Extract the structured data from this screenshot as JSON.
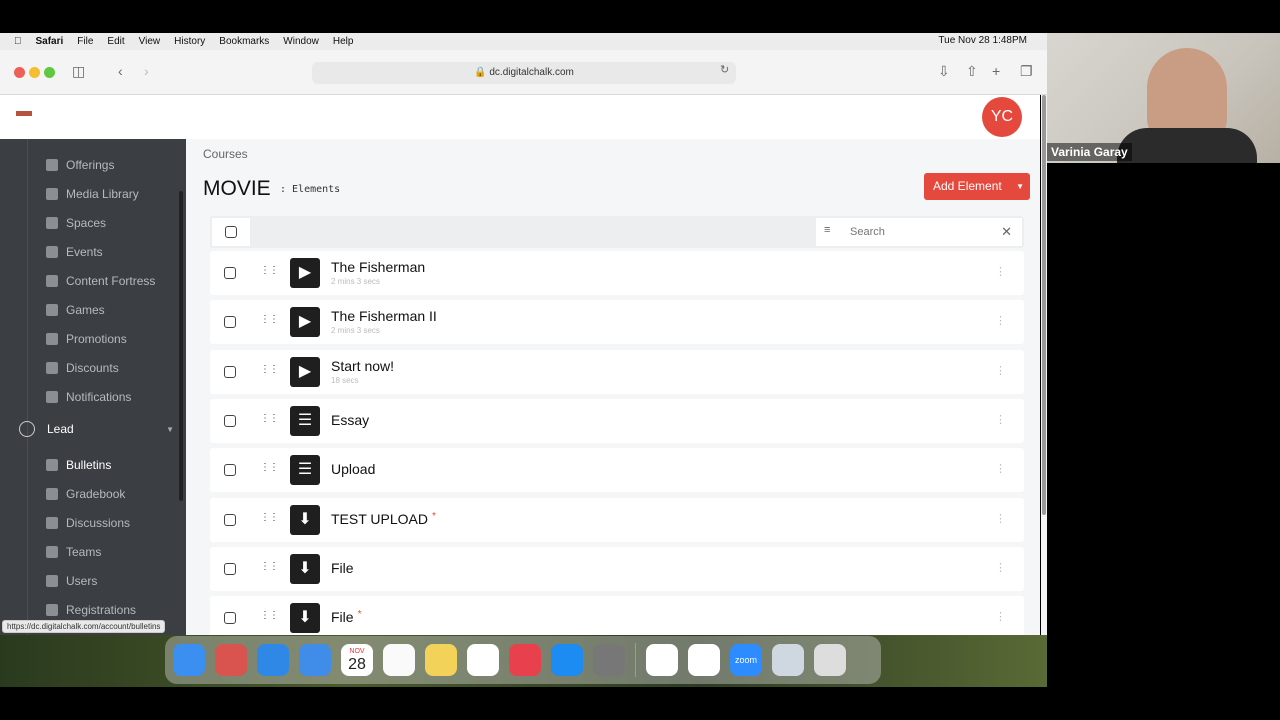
{
  "menubar": {
    "app": "Safari",
    "items": [
      "File",
      "Edit",
      "View",
      "History",
      "Bookmarks",
      "Window",
      "Help"
    ],
    "clock": "Tue Nov 28  1:48PM"
  },
  "browser": {
    "url": "dc.digitalchalk.com",
    "status_url": "https://dc.digitalchalk.com/account/bulletins"
  },
  "header": {
    "avatar": "YC"
  },
  "sidebar": {
    "items": [
      {
        "label": "Offerings",
        "icon": "offerings-icon"
      },
      {
        "label": "Media Library",
        "icon": "grid-icon"
      },
      {
        "label": "Spaces",
        "icon": "spaces-icon"
      },
      {
        "label": "Events",
        "icon": "calendar-icon"
      },
      {
        "label": "Content Fortress",
        "icon": "fortress-icon"
      },
      {
        "label": "Games",
        "icon": "games-icon"
      },
      {
        "label": "Promotions",
        "icon": "promotions-icon"
      },
      {
        "label": "Discounts",
        "icon": "discount-icon"
      },
      {
        "label": "Notifications",
        "icon": "mail-icon"
      }
    ],
    "section": "Lead",
    "lead_items": [
      {
        "label": "Bulletins"
      },
      {
        "label": "Gradebook"
      },
      {
        "label": "Discussions"
      },
      {
        "label": "Teams"
      },
      {
        "label": "Users"
      },
      {
        "label": "Registrations"
      }
    ]
  },
  "main": {
    "breadcrumb": "Courses",
    "title": "MOVIE",
    "subtitle": ": Elements",
    "add_button": "Add Element",
    "search_placeholder": "Search",
    "elements": [
      {
        "title": "The Fisherman",
        "sub": "2 mins 3 secs",
        "type": "video",
        "required": false
      },
      {
        "title": "The Fisherman II",
        "sub": "2 mins 3 secs",
        "type": "video",
        "required": false
      },
      {
        "title": "Start now!",
        "sub": "18 secs",
        "type": "video",
        "required": false
      },
      {
        "title": "Essay",
        "sub": "",
        "type": "text",
        "required": false
      },
      {
        "title": "Upload",
        "sub": "",
        "type": "text",
        "required": false
      },
      {
        "title": "TEST UPLOAD",
        "sub": "",
        "type": "download",
        "required": true
      },
      {
        "title": "File",
        "sub": "",
        "type": "download",
        "required": false
      },
      {
        "title": "File",
        "sub": "",
        "type": "download",
        "required": true
      }
    ],
    "required_mark": "*"
  },
  "colors": {
    "accent": "#e5483c",
    "sidebar": "#3b3e42"
  },
  "dock": {
    "apps": [
      "Finder",
      "Launchpad",
      "Safari",
      "Mail",
      "Calendar",
      "Reminders",
      "Notes",
      "Freeform",
      "News",
      "App Store",
      "System Settings",
      "Slack",
      "Chrome",
      "Zoom",
      "Preview",
      "Trash"
    ],
    "calendar_day": "28",
    "calendar_month": "NOV",
    "zoom_label": "zoom"
  },
  "video": {
    "name": "Varinia Garay"
  }
}
